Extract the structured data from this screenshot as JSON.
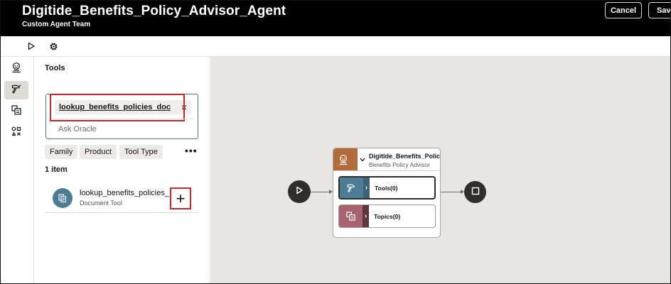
{
  "header": {
    "title": "Digitide_Benefits_Policy_Advisor_Agent",
    "subtitle": "Custom Agent Team",
    "cancel_label": "Cancel",
    "save_label": "Save"
  },
  "toolbar": {
    "icons": [
      "play-icon",
      "gear-icon"
    ]
  },
  "rail": {
    "items": [
      {
        "icon": "agent-icon",
        "active": false
      },
      {
        "icon": "tools-hammer-icon",
        "active": true
      },
      {
        "icon": "topics-icon",
        "active": false
      },
      {
        "icon": "variables-icon",
        "active": false
      }
    ]
  },
  "panel": {
    "title": "Tools",
    "search": {
      "chip_value": "lookup_benefits_policies_doc",
      "chip_close": "×",
      "placeholder": "Ask Oracle"
    },
    "filters": [
      "Family",
      "Product",
      "Tool Type"
    ],
    "more": "•••",
    "count": "1 item",
    "results": [
      {
        "name": "lookup_benefits_policies_",
        "type": "Document Tool",
        "icon": "document-tool-icon"
      }
    ],
    "add_symbol": "+"
  },
  "canvas": {
    "agent": {
      "name": "Digitide_Benefits_Polic...",
      "role": "Benefits Policy Advisor"
    },
    "tools_label": "Tools(0)",
    "topics_label": "Topics(0)",
    "chevron": "›"
  },
  "colors": {
    "header_bg": "#000000",
    "canvas_bg": "#e8e6e2",
    "highlight_red": "#c0282b",
    "agent_orange": "#b26b3a",
    "tools_teal": "#4d7c95",
    "topics_mauve": "#a86370",
    "node_dark": "#312d2a"
  }
}
